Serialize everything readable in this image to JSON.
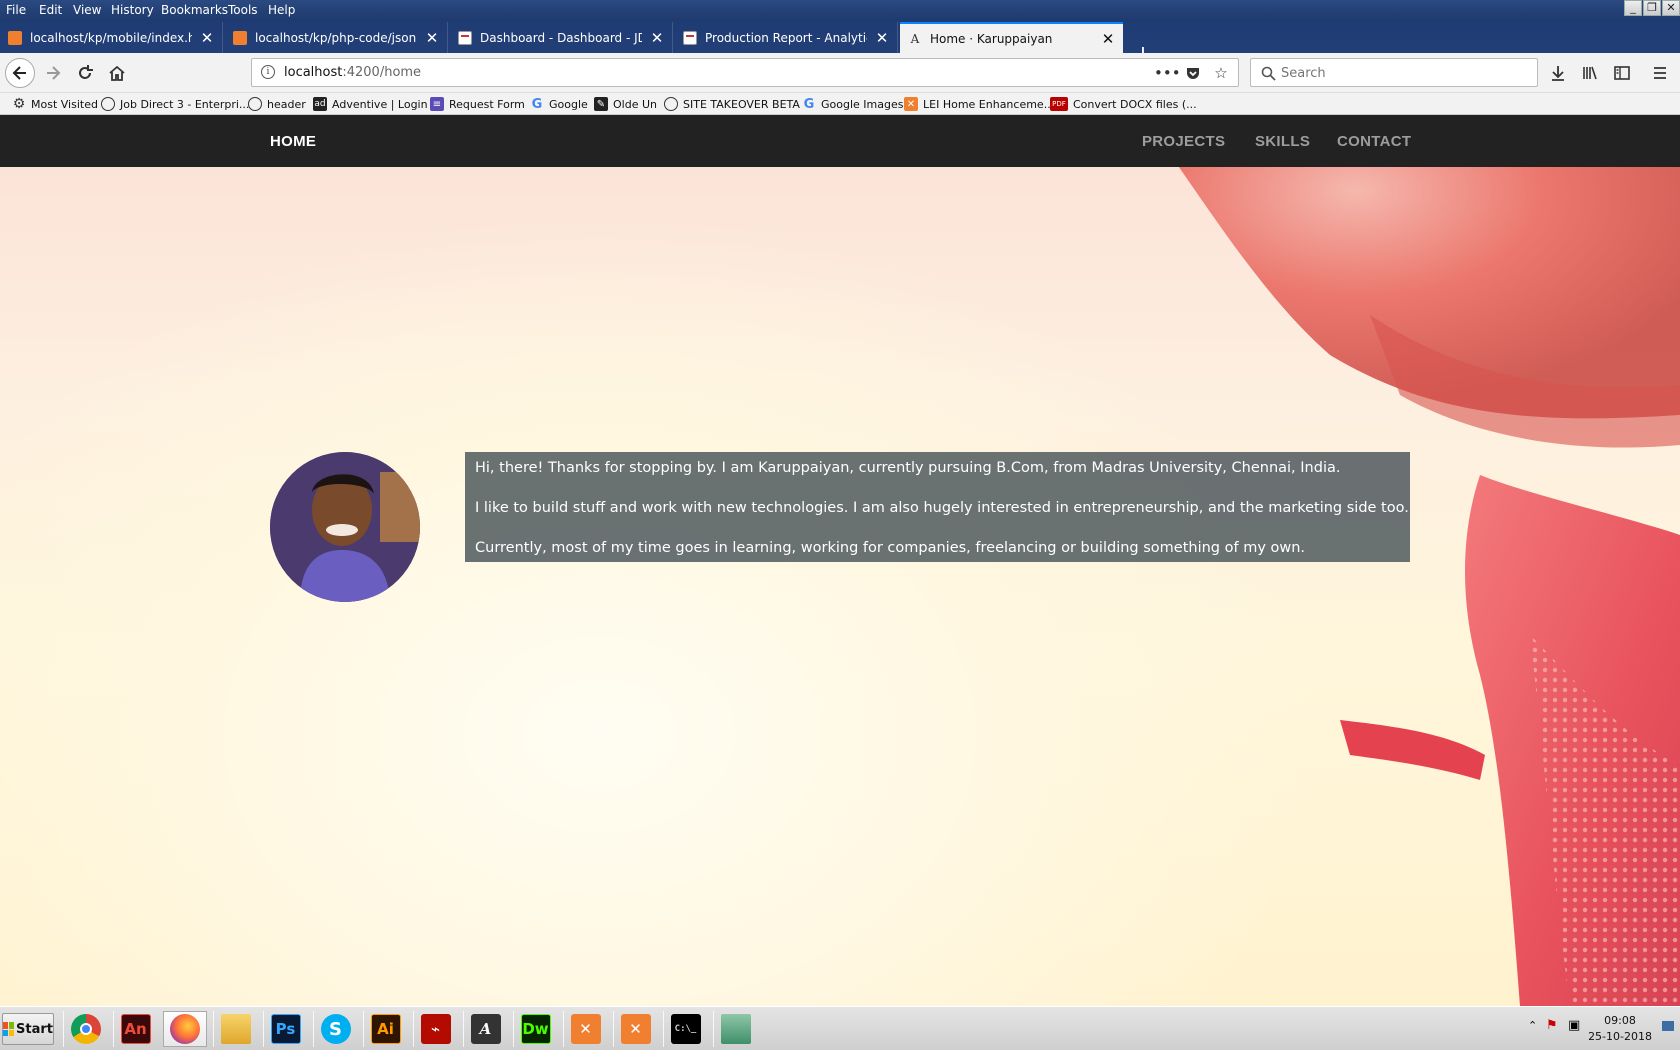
{
  "browser": {
    "menu": [
      "File",
      "Edit",
      "View",
      "History",
      "Bookmarks",
      "Tools",
      "Help"
    ],
    "tabs": [
      {
        "title": "localhost/kp/mobile/index.html",
        "icon": "xampp-icon",
        "active": false
      },
      {
        "title": "localhost/kp/php-code/json.php",
        "icon": "xampp-icon",
        "active": false
      },
      {
        "title": "Dashboard - Dashboard - JD Work",
        "icon": "document-icon",
        "active": false
      },
      {
        "title": "Production Report - Analytics - JD",
        "icon": "document-icon",
        "active": false
      },
      {
        "title": "Home · Karuppaiyan",
        "icon": "letter-a-icon",
        "active": true
      }
    ],
    "new_tab": "+",
    "url": {
      "host": "localhost",
      "path": ":4200/home"
    },
    "search_placeholder": "Search",
    "bookmarks": [
      {
        "label": "Most Visited",
        "icon": "gear-icon"
      },
      {
        "label": "Job Direct 3 - Enterpri...",
        "icon": "globe-icon"
      },
      {
        "label": "header",
        "icon": "globe-icon"
      },
      {
        "label": "Adventive | Login",
        "icon": "ad-icon"
      },
      {
        "label": "Request Form",
        "icon": "form-icon"
      },
      {
        "label": "Google",
        "icon": "google-icon"
      },
      {
        "label": "Olde Un",
        "icon": "olde-icon"
      },
      {
        "label": "SITE TAKEOVER BETA",
        "icon": "globe-icon"
      },
      {
        "label": "Google Images",
        "icon": "google-icon"
      },
      {
        "label": "LEI Home Enhanceme...",
        "icon": "xampp-icon"
      },
      {
        "label": "Convert DOCX files (...",
        "icon": "pdf-icon"
      }
    ]
  },
  "site": {
    "nav": {
      "home": "HOME",
      "projects": "PROJECTS",
      "skills": "SKILLS",
      "contact": "CONTACT"
    },
    "about": {
      "p1": "Hi, there! Thanks for stopping by. I am Karuppaiyan, currently pursuing B.Com, from Madras University, Chennai, India.",
      "p2": "I like to build stuff and work with new technologies. I am also hugely interested in entrepreneurship, and the marketing side too.",
      "p3": "Currently, most of my time goes in learning, working for companies, freelancing or building something of my own."
    }
  },
  "taskbar": {
    "start_label": "Start",
    "apps": [
      {
        "name": "chrome-icon",
        "label": ""
      },
      {
        "name": "animate-icon",
        "label": "An"
      },
      {
        "name": "firefox-icon",
        "label": ""
      },
      {
        "name": "file-explorer-icon",
        "label": ""
      },
      {
        "name": "photoshop-icon",
        "label": "Ps"
      },
      {
        "name": "skype-icon",
        "label": "S"
      },
      {
        "name": "illustrator-icon",
        "label": "Ai"
      },
      {
        "name": "acrobat-icon",
        "label": ""
      },
      {
        "name": "font-app-icon",
        "label": "A"
      },
      {
        "name": "dreamweaver-icon",
        "label": "Dw"
      },
      {
        "name": "xampp-icon",
        "label": ""
      },
      {
        "name": "xampp-icon",
        "label": ""
      },
      {
        "name": "command-prompt-icon",
        "label": "C:\\_"
      },
      {
        "name": "network-icon",
        "label": ""
      }
    ],
    "clock": {
      "time": "09:08",
      "date": "25-10-2018"
    }
  },
  "colors": {
    "site_nav_bg": "#222222",
    "nav_inactive": "#9d9d9d",
    "about_box_bg": "#5f6668",
    "browser_chrome": "#1f3a6e",
    "tab_active_accent": "#0a84ff"
  }
}
